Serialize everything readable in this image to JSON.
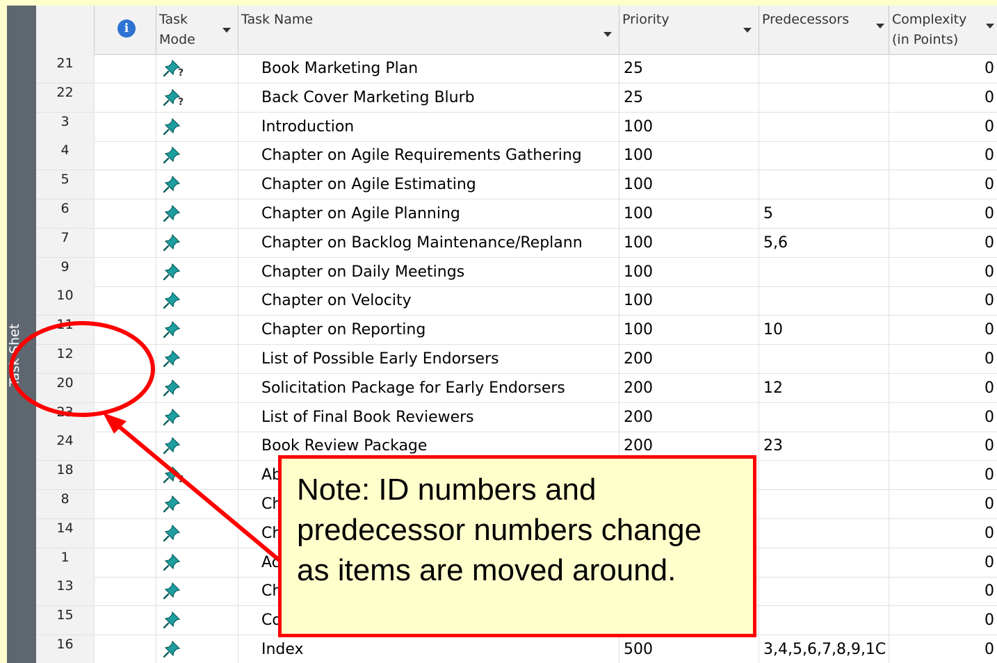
{
  "sidebar": {
    "label": "Task Shet"
  },
  "header": {
    "info_icon": "info-icon",
    "task_mode": "Task Mode",
    "task_name": "Task Name",
    "priority": "Priority",
    "predecessors": "Predecessors",
    "complexity": "Complexity (in Points)"
  },
  "rows": [
    {
      "id": "21",
      "mode": "manual-unknown",
      "name": "Book Marketing Plan",
      "priority": "25",
      "predecessors": "",
      "complexity": "0"
    },
    {
      "id": "22",
      "mode": "manual-unknown",
      "name": "Back Cover Marketing Blurb",
      "priority": "25",
      "predecessors": "",
      "complexity": "0"
    },
    {
      "id": "3",
      "mode": "manual",
      "name": "Introduction",
      "priority": "100",
      "predecessors": "",
      "complexity": "0"
    },
    {
      "id": "4",
      "mode": "manual",
      "name": "Chapter on Agile Requirements Gathering",
      "priority": "100",
      "predecessors": "",
      "complexity": "0"
    },
    {
      "id": "5",
      "mode": "manual",
      "name": "Chapter on Agile Estimating",
      "priority": "100",
      "predecessors": "",
      "complexity": "0"
    },
    {
      "id": "6",
      "mode": "manual",
      "name": "Chapter on Agile Planning",
      "priority": "100",
      "predecessors": "5",
      "complexity": "0"
    },
    {
      "id": "7",
      "mode": "manual",
      "name": "Chapter on Backlog Maintenance/Replann",
      "priority": "100",
      "predecessors": "5,6",
      "complexity": "0"
    },
    {
      "id": "9",
      "mode": "manual",
      "name": "Chapter on Daily Meetings",
      "priority": "100",
      "predecessors": "",
      "complexity": "0"
    },
    {
      "id": "10",
      "mode": "manual",
      "name": "Chapter on Velocity",
      "priority": "100",
      "predecessors": "",
      "complexity": "0"
    },
    {
      "id": "11",
      "mode": "manual",
      "name": "Chapter on Reporting",
      "priority": "100",
      "predecessors": "10",
      "complexity": "0"
    },
    {
      "id": "12",
      "mode": "manual",
      "name": "List of Possible Early Endorsers",
      "priority": "200",
      "predecessors": "",
      "complexity": "0"
    },
    {
      "id": "20",
      "mode": "manual",
      "name": "Solicitation Package for Early Endorsers",
      "priority": "200",
      "predecessors": "12",
      "complexity": "0"
    },
    {
      "id": "23",
      "mode": "manual",
      "name": "List of Final Book Reviewers",
      "priority": "200",
      "predecessors": "",
      "complexity": "0"
    },
    {
      "id": "24",
      "mode": "manual",
      "name": "Book Review Package",
      "priority": "200",
      "predecessors": "23",
      "complexity": "0"
    },
    {
      "id": "18",
      "mode": "manual-unknown",
      "name": "Ab",
      "priority": "",
      "predecessors": "",
      "complexity": "0"
    },
    {
      "id": "8",
      "mode": "manual",
      "name": "Ch",
      "priority": "",
      "predecessors": "",
      "complexity": "0"
    },
    {
      "id": "14",
      "mode": "manual",
      "name": "Ch",
      "priority": "",
      "predecessors": "",
      "complexity": "0"
    },
    {
      "id": "1",
      "mode": "manual",
      "name": "Ac",
      "priority": "",
      "predecessors": "",
      "complexity": "0"
    },
    {
      "id": "13",
      "mode": "manual",
      "name": "Ch",
      "priority": "",
      "predecessors": "",
      "complexity": "0"
    },
    {
      "id": "15",
      "mode": "manual",
      "name": "Co",
      "priority": "",
      "predecessors": "",
      "complexity": "0"
    },
    {
      "id": "16",
      "mode": "manual",
      "name": "Index",
      "priority": "500",
      "predecessors": "3,4,5,6,7,8,9,1C",
      "complexity": "0"
    }
  ],
  "annotation": {
    "note": "Note:  ID numbers and predecessor numbers change as items are moved around.",
    "highlight_color": "#FF0000",
    "box_fill": "#FFFFCC"
  },
  "colors": {
    "slide_bg": "#FFFFCC",
    "sidebar": "#5E6670",
    "pin": "#1E9E9E"
  }
}
